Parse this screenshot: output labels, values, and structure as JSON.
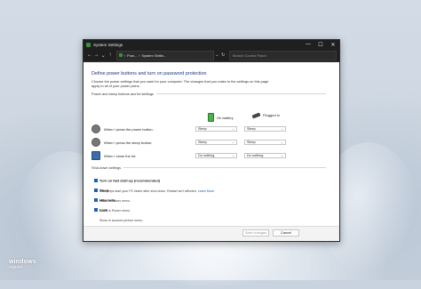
{
  "window": {
    "title": "System Settings",
    "minimize": "—",
    "maximize": "☐",
    "close": "✕"
  },
  "nav": {
    "back": "←",
    "forward": "→",
    "up_recent": "⌄",
    "up": "↑",
    "breadcrumb_1": "Pow...",
    "breadcrumb_2": "System Settin...",
    "breadcrumb_sep": "›",
    "dropdown": "⌄",
    "refresh": "↻",
    "search_placeholder": "Search Control Panel"
  },
  "page": {
    "heading": "Define power buttons and turn on password protection",
    "description": "Choose the power settings that you want for your computer. The changes that you make to the settings on this page apply to all of your power plans."
  },
  "power_section": {
    "title": "Power and sleep buttons and lid settings",
    "on_battery": "On battery",
    "plugged_in": "Plugged in",
    "rows": [
      {
        "label": "When I press the power button:",
        "battery": "Sleep",
        "plugged": "Sleep"
      },
      {
        "label": "When I press the sleep button:",
        "battery": "Sleep",
        "plugged": "Sleep"
      },
      {
        "label": "When I close the lid:",
        "battery": "Do nothing",
        "plugged": "Do nothing"
      }
    ]
  },
  "shutdown_section": {
    "title": "Shut-down settings",
    "items": [
      {
        "label": "Turn on fast start-up (recommended)",
        "sub": "This helps start your PC faster after shut-down. Restart isn't affected.",
        "link": "Learn More"
      },
      {
        "label": "Sleep",
        "sub": "Show in Power menu."
      },
      {
        "label": "Hibernate",
        "sub": "Show in Power menu."
      },
      {
        "label": "Lock",
        "sub": "Show in account picture menu."
      }
    ]
  },
  "footer": {
    "save": "Save changes",
    "cancel": "Cancel"
  },
  "watermark": {
    "line1": "windows",
    "line2": "report"
  },
  "colors": {
    "accent": "#1d5fb4",
    "heading": "#1e3287",
    "titlebar": "#1f1f1f"
  }
}
